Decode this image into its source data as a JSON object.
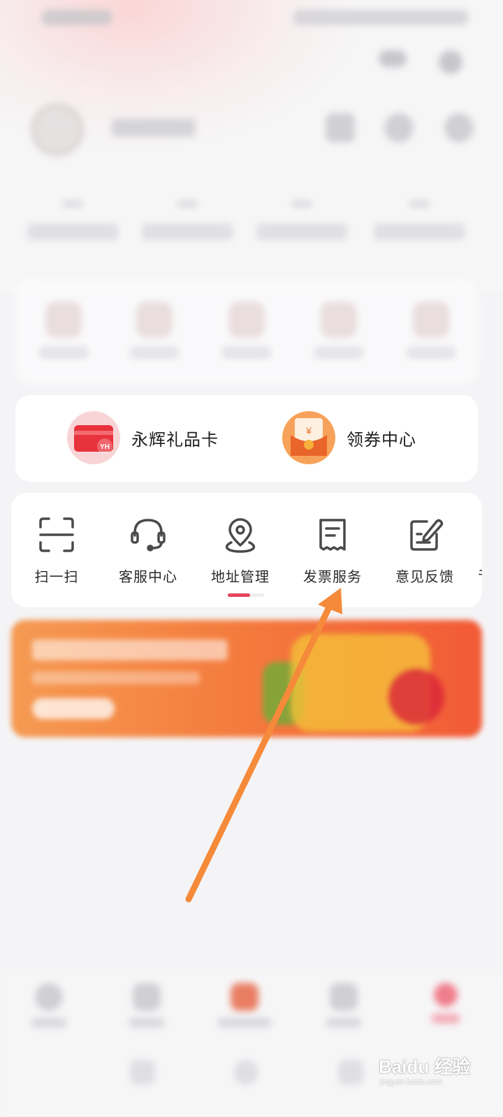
{
  "gift_row": {
    "gift_card_label": "永辉礼品卡",
    "gift_card_badge": "YH",
    "coupon_center_label": "领券中心",
    "coupon_badge_symbol": "¥"
  },
  "services": {
    "items": [
      {
        "label": "扫一扫",
        "icon": "scan-icon"
      },
      {
        "label": "客服中心",
        "icon": "headset-icon"
      },
      {
        "label": "地址管理",
        "icon": "location-pin-icon"
      },
      {
        "label": "发票服务",
        "icon": "invoice-icon"
      },
      {
        "label": "意见反馈",
        "icon": "feedback-edit-icon"
      }
    ],
    "next_item_partial": "书",
    "page_indicator": {
      "current_page": 1,
      "total_pages": 2
    }
  },
  "watermark": {
    "main": "Baidu 经验",
    "sub": "jingyan.baidu.com"
  },
  "colors": {
    "accent": "#e4465b",
    "annotation_arrow": "#f58a3a",
    "gift_card_red": "#e8323c",
    "coupon_orange": "#f7a25a",
    "icon_gray": "#4a4a4a"
  }
}
